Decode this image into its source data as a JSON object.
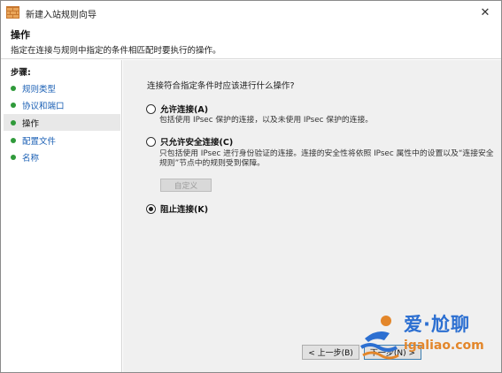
{
  "window": {
    "title": "新建入站规则向导"
  },
  "header": {
    "title": "操作",
    "description": "指定在连接与规则中指定的条件相匹配时要执行的操作。"
  },
  "sidebar": {
    "title": "步骤:",
    "items": [
      {
        "label": "规则类型",
        "active": false
      },
      {
        "label": "协议和端口",
        "active": false
      },
      {
        "label": "操作",
        "active": true
      },
      {
        "label": "配置文件",
        "active": false
      },
      {
        "label": "名称",
        "active": false
      }
    ]
  },
  "main": {
    "question": "连接符合指定条件时应该进行什么操作?",
    "options": [
      {
        "label": "允许连接(A)",
        "checked": false,
        "description": "包括使用 IPsec 保护的连接，以及未使用 IPsec 保护的连接。"
      },
      {
        "label": "只允许安全连接(C)",
        "checked": false,
        "description": "只包括使用 IPsec 进行身份验证的连接。连接的安全性将依照 IPsec 属性中的设置以及“连接安全规则”节点中的规则受到保障。"
      },
      {
        "label": "阻止连接(K)",
        "checked": true,
        "description": ""
      }
    ],
    "customize_label": "自定义"
  },
  "footer": {
    "back_label": "< 上一步(B)",
    "next_label": "下一步(N) >"
  },
  "watermark": {
    "brand": "爱·尬聊",
    "url": "igaliao.com"
  },
  "colors": {
    "link": "#1a5fb4",
    "step_dot": "#2f9a3a",
    "watermark_blue": "#2c6fd1",
    "watermark_orange": "#e3862a"
  }
}
